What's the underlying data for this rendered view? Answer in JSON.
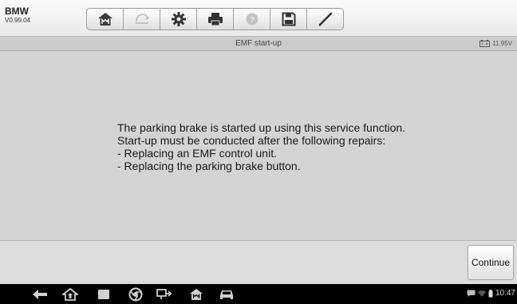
{
  "app": {
    "brand": "BMW",
    "version": "V0.99.04"
  },
  "toolbar": {
    "buttons": [
      {
        "icon": "home-icon"
      },
      {
        "icon": "vehicle-swap-icon"
      },
      {
        "icon": "settings-gear-icon"
      },
      {
        "icon": "print-icon"
      },
      {
        "icon": "help-icon"
      },
      {
        "icon": "save-icon"
      },
      {
        "icon": "data-logging-icon"
      }
    ]
  },
  "titlebar": {
    "title": "EMF start-up",
    "voltage": "11.95V"
  },
  "message": {
    "lines": [
      "The parking brake is started up using this service function.",
      "Start-up must be conducted after the following repairs:",
      "- Replacing an EMF control unit.",
      "- Replacing the parking brake button."
    ]
  },
  "actions": {
    "continue_label": "Continue"
  },
  "system_bar": {
    "time": "10:47"
  },
  "colors": {
    "content_bg": "#d4d4d4",
    "titlebar_bg": "#cbcbcb",
    "navbar_bg": "#000000"
  }
}
